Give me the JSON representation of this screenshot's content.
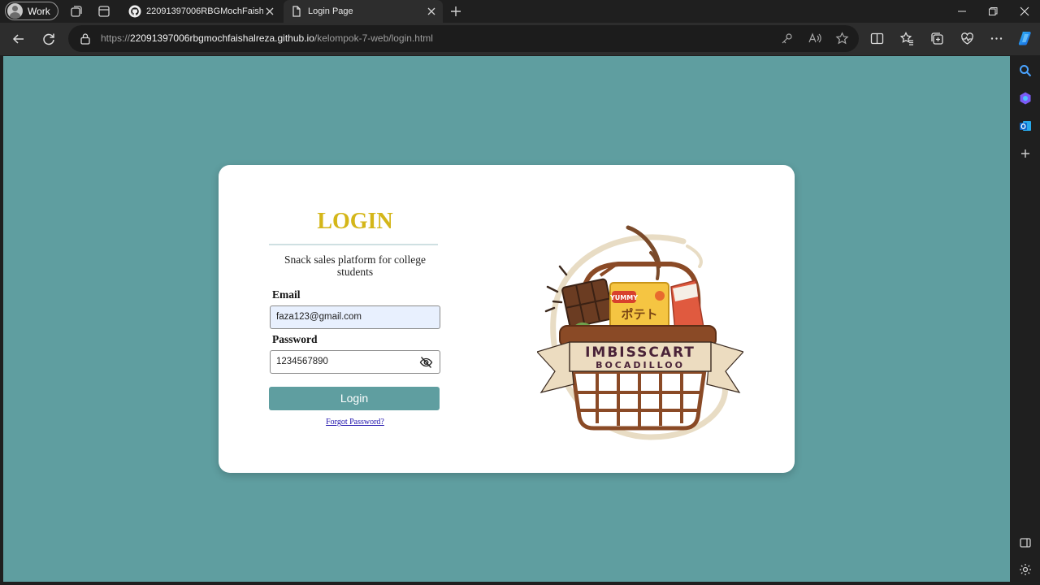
{
  "browser": {
    "profile_label": "Work",
    "tabs": [
      {
        "title": "22091397006RBGMochFaishalRe",
        "icon": "github-icon",
        "active": false
      },
      {
        "title": "Login Page",
        "icon": "page-icon",
        "active": true
      }
    ],
    "url_host": "22091397006rbgmochfaishalreza.github.io",
    "url_path": "/kelompok-7-web/login.html",
    "url_prefix": "https://"
  },
  "page": {
    "title": "LOGIN",
    "tagline": "Snack sales platform for college students",
    "email_label": "Email",
    "email_value": "faza123@gmail.com",
    "password_label": "Password",
    "password_value": "1234567890",
    "login_button": "Login",
    "forgot_link": "Forgot Password?",
    "logo": {
      "brand": "IMBISSCART",
      "subtitle": "BOCADILLOO",
      "snack_label": "YUMMY",
      "snack_text": "ポテト"
    }
  },
  "colors": {
    "background": "#5f9ea0",
    "title": "#d4b619",
    "button": "#5f9ea0",
    "link": "#1a0dab"
  }
}
